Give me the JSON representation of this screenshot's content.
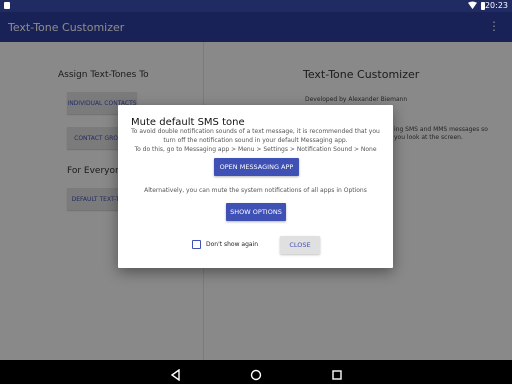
{
  "status_bar": {
    "time": "20:23"
  },
  "app_bar": {
    "title": "Text-Tone Customizer",
    "overflow_icon": "more-vert-icon"
  },
  "left_panel": {
    "assign_heading": "Assign Text-Tones To",
    "individual_contacts": "INDIVIDUAL CONTACTS",
    "contact_groups": "CONTACT GROUPS",
    "for_everyone_heading": "For Everyone",
    "default_text_tone": "DEFAULT TEXT-TONE"
  },
  "right_panel": {
    "title": "Text-Tone Customizer",
    "developer": "Developed by Alexander Biemann",
    "desc_line1": "ing SMS and MMS messages so",
    "desc_line2": "you look at the screen."
  },
  "dialog": {
    "title": "Mute default SMS tone",
    "message_line1": "To avoid double notification sounds of a text message, it is recommended that you",
    "message_line2": "turn off the notification sound in your default Messaging app.",
    "message_line3": "To do this, go to Messaging app > Menu > Settings > Notification Sound > None",
    "open_messaging_app": "OPEN MESSAGING APP",
    "alt_message": "Alternatively, you can mute the system notifications of all apps in Options",
    "show_options": "SHOW OPTIONS",
    "dont_show_again": "Don't show again",
    "close": "CLOSE"
  },
  "colors": {
    "app_bar": "#2f3f9e",
    "status_bar": "#202a63",
    "accent": "#3f51b5"
  }
}
